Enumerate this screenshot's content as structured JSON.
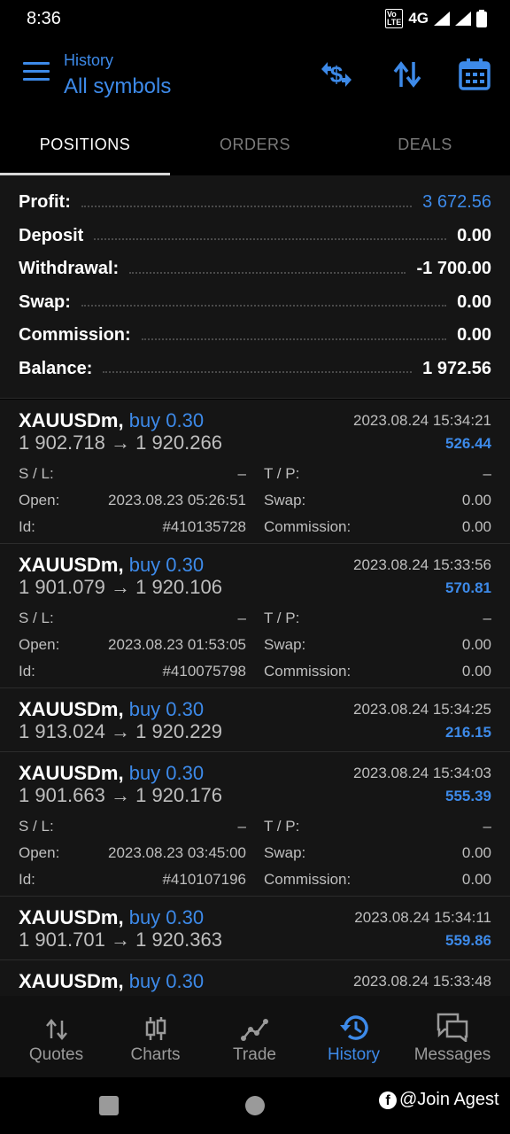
{
  "status_bar": {
    "time": "8:36",
    "network": "4G",
    "volte": "VoLTE2"
  },
  "header": {
    "subtitle": "History",
    "title": "All symbols"
  },
  "tabs": [
    {
      "label": "POSITIONS",
      "active": true
    },
    {
      "label": "ORDERS",
      "active": false
    },
    {
      "label": "DEALS",
      "active": false
    }
  ],
  "summary": [
    {
      "label": "Profit:",
      "value": "3 672.56"
    },
    {
      "label": "Deposit",
      "value": "0.00"
    },
    {
      "label": "Withdrawal:",
      "value": "-1 700.00"
    },
    {
      "label": "Swap:",
      "value": "0.00"
    },
    {
      "label": "Commission:",
      "value": "0.00"
    },
    {
      "label": "Balance:",
      "value": "1 972.56"
    }
  ],
  "labels": {
    "sl": "S / L:",
    "tp": "T / P:",
    "open": "Open:",
    "swap": "Swap:",
    "id": "Id:",
    "commission": "Commission:"
  },
  "positions": [
    {
      "symbol": "XAUUSDm,",
      "direction": "buy 0.30",
      "close_time": "2023.08.24 15:34:21",
      "prices": "1 902.718 → 1 920.266",
      "profit": "526.44",
      "sl": "–",
      "tp": "–",
      "open": "2023.08.23 05:26:51",
      "swap": "0.00",
      "id": "#410135728",
      "commission": "0.00"
    },
    {
      "symbol": "XAUUSDm,",
      "direction": "buy 0.30",
      "close_time": "2023.08.24 15:33:56",
      "prices": "1 901.079 → 1 920.106",
      "profit": "570.81",
      "sl": "–",
      "tp": "–",
      "open": "2023.08.23 01:53:05",
      "swap": "0.00",
      "id": "#410075798",
      "commission": "0.00"
    },
    {
      "symbol": "XAUUSDm,",
      "direction": "buy 0.30",
      "close_time": "2023.08.24 15:34:25",
      "prices": "1 913.024 → 1 920.229",
      "profit": "216.15"
    },
    {
      "symbol": "XAUUSDm,",
      "direction": "buy 0.30",
      "close_time": "2023.08.24 15:34:03",
      "prices": "1 901.663 → 1 920.176",
      "profit": "555.39",
      "sl": "–",
      "tp": "–",
      "open": "2023.08.23 03:45:00",
      "swap": "0.00",
      "id": "#410107196",
      "commission": "0.00"
    },
    {
      "symbol": "XAUUSDm,",
      "direction": "buy 0.30",
      "close_time": "2023.08.24 15:34:11",
      "prices": "1 901.701 → 1 920.363",
      "profit": "559.86"
    },
    {
      "symbol": "XAUUSDm,",
      "direction": "buy 0.30",
      "close_time": "2023.08.24 15:33:48"
    }
  ],
  "bottom_nav": [
    {
      "label": "Quotes",
      "icon": "quotes-icon"
    },
    {
      "label": "Charts",
      "icon": "charts-icon"
    },
    {
      "label": "Trade",
      "icon": "trade-icon"
    },
    {
      "label": "History",
      "icon": "history-icon",
      "active": true
    },
    {
      "label": "Messages",
      "icon": "messages-icon"
    }
  ],
  "watermark": "@Join Agest",
  "colors": {
    "accent": "#3d8ae9",
    "background": "#000000",
    "panel": "#151515"
  }
}
